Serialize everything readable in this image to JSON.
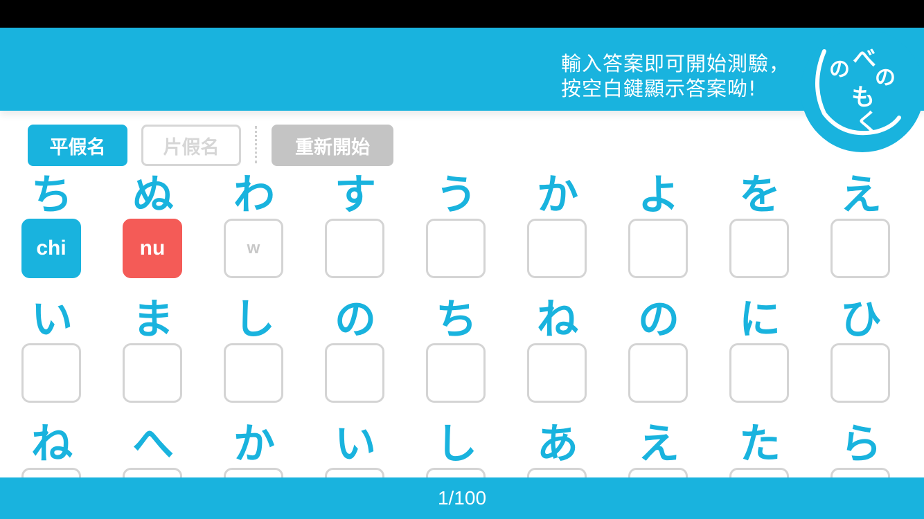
{
  "header": {
    "message_line1": "輸入答案即可開始測驗，",
    "message_line2": "按空白鍵顯示答案呦!",
    "logo_text": [
      "べ",
      "の",
      "の",
      "も",
      "く"
    ],
    "logo_color": "#19b3de"
  },
  "toolbar": {
    "hiragana_label": "平假名",
    "katakana_label": "片假名",
    "restart_label": "重新開始"
  },
  "rows": [
    {
      "kana": [
        "ち",
        "ぬ",
        "わ",
        "す",
        "う",
        "か",
        "よ",
        "を",
        "え"
      ],
      "answers": [
        "chi",
        "nu",
        "w",
        "",
        "",
        "",
        "",
        "",
        ""
      ],
      "states": [
        "correct",
        "wrong",
        "typing",
        "empty",
        "empty",
        "empty",
        "empty",
        "empty",
        "empty"
      ]
    },
    {
      "kana": [
        "い",
        "ま",
        "し",
        "の",
        "ち",
        "ね",
        "の",
        "に",
        "ひ"
      ],
      "answers": [
        "",
        "",
        "",
        "",
        "",
        "",
        "",
        "",
        ""
      ],
      "states": [
        "empty",
        "empty",
        "empty",
        "empty",
        "empty",
        "empty",
        "empty",
        "empty",
        "empty"
      ]
    },
    {
      "kana": [
        "ね",
        "へ",
        "か",
        "い",
        "し",
        "あ",
        "え",
        "た",
        "ら"
      ],
      "answers": [
        "",
        "",
        "",
        "",
        "",
        "",
        "",
        "",
        ""
      ],
      "states": [
        "empty",
        "empty",
        "empty",
        "empty",
        "empty",
        "empty",
        "empty",
        "empty",
        "empty"
      ]
    }
  ],
  "footer": {
    "progress": "1/100"
  },
  "colors": {
    "accent": "#19b3de",
    "correct": "#19b3de",
    "wrong": "#f45b57",
    "disabled": "#c4c4c4"
  }
}
